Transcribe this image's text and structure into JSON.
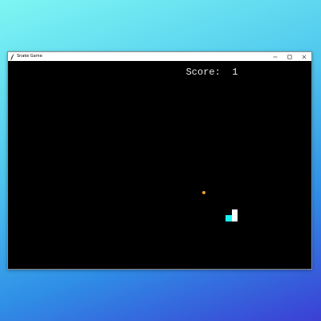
{
  "window": {
    "title": "Snake Game",
    "icon": "feather-icon",
    "controls": [
      "minimize-icon",
      "maximize-icon",
      "close-icon"
    ]
  },
  "game": {
    "score_label": "Score:",
    "score_value": "1",
    "score_text": "Score:  1",
    "colors": {
      "background": "#000000",
      "food": "#f0a12a",
      "snake_head": "#ffffff",
      "snake_body": "#19f0f0",
      "score_text": "#e8e8e8"
    }
  },
  "desktop": {
    "gradient": [
      "#7ef6f3",
      "#4fc7ee",
      "#2f8fe6",
      "#3b3fd4"
    ]
  }
}
